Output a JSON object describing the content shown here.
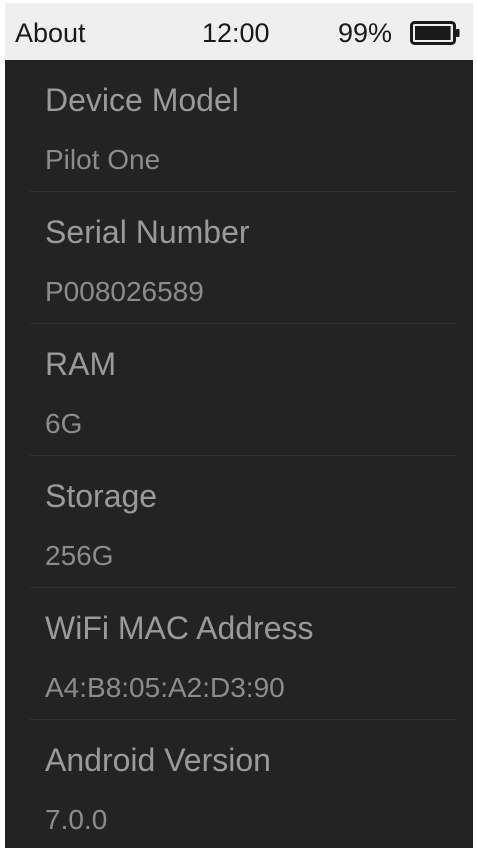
{
  "status_bar": {
    "title": "About",
    "time": "12:00",
    "battery_percent": "99%",
    "battery_icon": "battery-icon",
    "battery_level": 0.99
  },
  "items": [
    {
      "label": "Device Model",
      "value": "Pilot One"
    },
    {
      "label": "Serial Number",
      "value": "P008026589"
    },
    {
      "label": "RAM",
      "value": "6G"
    },
    {
      "label": "Storage",
      "value": "256G"
    },
    {
      "label": "WiFi MAC Address",
      "value": "A4:B8:05:A2:D3:90"
    },
    {
      "label": "Android Version",
      "value": "7.0.0"
    }
  ],
  "colors": {
    "background": "#232323",
    "status_bar": "#efefef",
    "label_text": "#9a9a9a",
    "value_text": "#8c8c8c"
  }
}
